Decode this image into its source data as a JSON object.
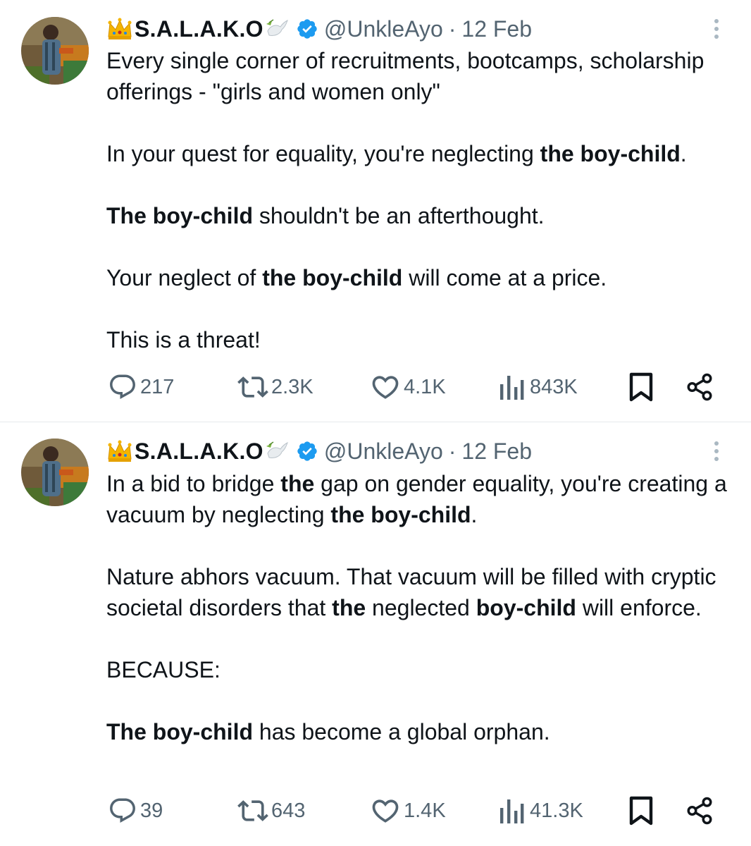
{
  "colors": {
    "text": "#0f1419",
    "muted": "#536471",
    "verified": "#1d9bf0",
    "divider": "#e6e9ec"
  },
  "tweets": [
    {
      "display_name": "S.A.L.A.K.O",
      "handle": "@UnkleAyo",
      "separator": "·",
      "date": "12 Feb",
      "paragraphs": [
        [
          "Every single corner of recruitments, bootcamps, scholarship offerings - \"girls and women only\""
        ],
        [
          "In your quest for equality, you're neglecting ",
          "the boy-child",
          "."
        ],
        [
          "The boy-child",
          " shouldn't be an afterthought."
        ],
        [
          "Your neglect of ",
          "the boy-child",
          " will come at a price."
        ],
        [
          "This is a threat!"
        ]
      ],
      "replies": "217",
      "reposts": "2.3K",
      "likes": "4.1K",
      "views": "843K"
    },
    {
      "display_name": "S.A.L.A.K.O",
      "handle": "@UnkleAyo",
      "separator": "·",
      "date": "12 Feb",
      "paragraphs": [
        [
          "In a bid to bridge ",
          "the",
          " gap on gender equality, you're creating a vacuum by neglecting ",
          "the boy-child",
          "."
        ],
        [
          "Nature abhors vacuum. That vacuum will be filled with cryptic societal disorders that ",
          "the",
          " neglected ",
          "boy-child",
          " will enforce."
        ],
        [
          "BECAUSE:"
        ],
        [
          "The boy-child",
          " has become a global orphan."
        ]
      ],
      "replies": "39",
      "reposts": "643",
      "likes": "1.4K",
      "views": "41.3K"
    }
  ]
}
